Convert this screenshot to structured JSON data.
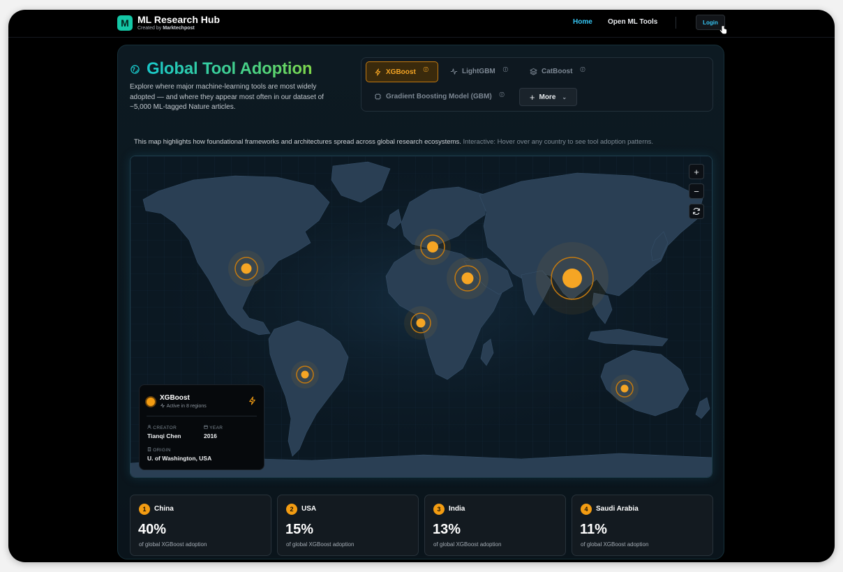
{
  "brand": {
    "logo_letter": "M",
    "title": "ML Research Hub",
    "subtitle_prefix": "Created by",
    "subtitle_name": "Marktechpost"
  },
  "nav": {
    "home": "Home",
    "tools": "Open ML Tools",
    "login": "Login"
  },
  "header": {
    "title": "Global Tool Adoption",
    "description": "Explore where major machine-learning tools are most widely adopted — and where they appear most often in our dataset of ~5,000 ML-tagged Nature articles."
  },
  "tools": {
    "xgboost": "XGBoost",
    "lightgbm": "LightGBM",
    "catboost": "CatBoost",
    "gbm": "Gradient Boosting Model (GBM)",
    "info_glyph": "ⓘ",
    "more": "More",
    "selected": "XGBoost"
  },
  "caption": {
    "main": "This map highlights how foundational frameworks and architectures spread across global research ecosystems.",
    "hint": "Interactive: Hover over any country to see tool adoption patterns."
  },
  "map_controls": {
    "zoom_in": "+",
    "zoom_out": "−",
    "reset": "⟳"
  },
  "info_card": {
    "title": "XGBoost",
    "status": "Active in 8 regions",
    "creator_label": "CREATOR",
    "creator": "Tianqi Chen",
    "year_label": "YEAR",
    "year": "2016",
    "origin_label": "ORIGIN",
    "origin": "U. of Washington, USA"
  },
  "stats": [
    {
      "rank": "1",
      "country": "China",
      "percent": "40%",
      "note": "of global XGBoost adoption"
    },
    {
      "rank": "2",
      "country": "USA",
      "percent": "15%",
      "note": "of global XGBoost adoption"
    },
    {
      "rank": "3",
      "country": "India",
      "percent": "13%",
      "note": "of global XGBoost adoption"
    },
    {
      "rank": "4",
      "country": "Saudi Arabia",
      "percent": "11%",
      "note": "of global XGBoost adoption"
    }
  ],
  "colors": {
    "accent": "#f39c12",
    "link": "#36c6f4",
    "title_gradient_start": "#19c7c9",
    "title_gradient_end": "#7fd64a",
    "land": "#2a3f54"
  }
}
